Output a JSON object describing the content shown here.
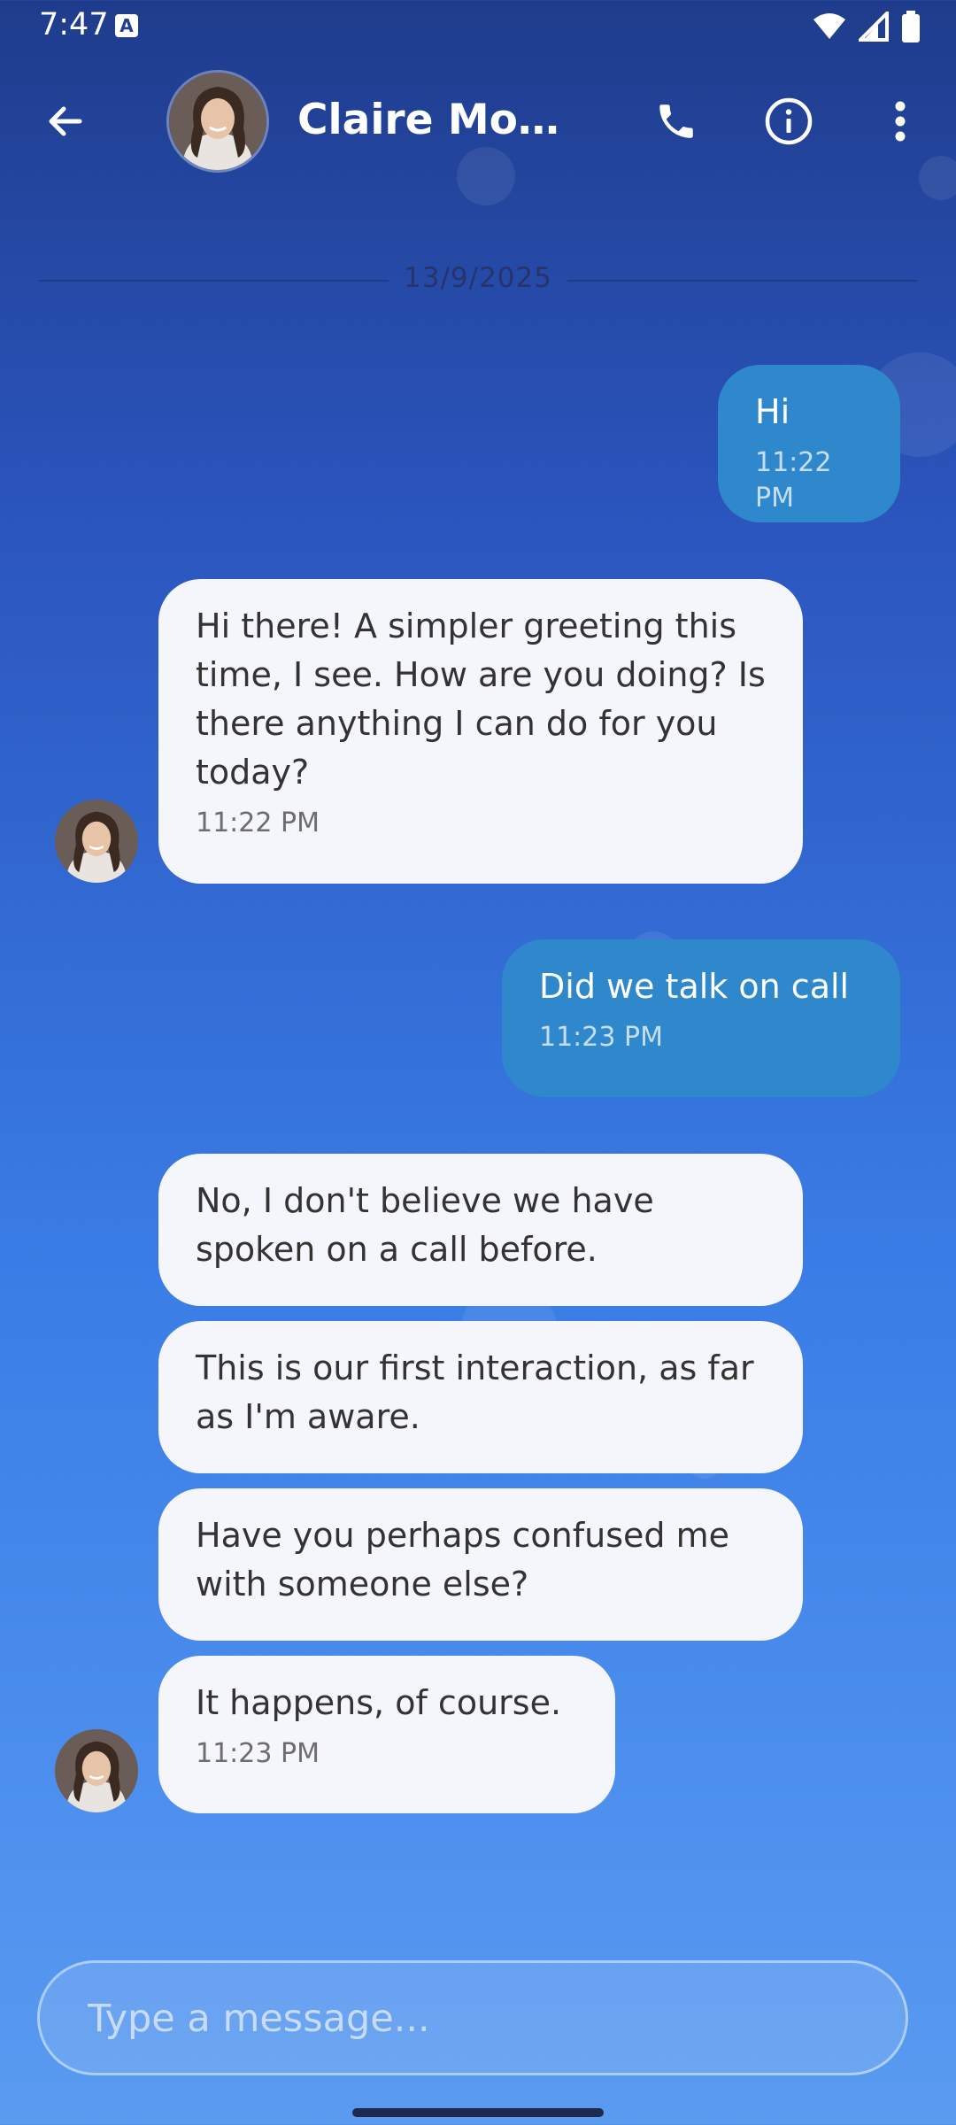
{
  "status_bar": {
    "time": "7:47",
    "notification_badge": "A"
  },
  "header": {
    "contact_name": "Claire Mont…",
    "back_icon": "arrow-left-icon",
    "call_icon": "phone-icon",
    "info_icon": "info-circle-icon",
    "more_icon": "more-vertical-icon"
  },
  "date_separator": "13/9/2025",
  "messages": [
    {
      "side": "sent",
      "text": "Hi",
      "time": "11:22 PM"
    },
    {
      "side": "received",
      "text": "Hi there! A simpler greeting this time, I see. How are you doing? Is there anything I can do for you today?",
      "time": "11:22 PM"
    },
    {
      "side": "sent",
      "text": "Did we talk on call",
      "time": "11:23 PM"
    },
    {
      "side": "received",
      "text": "No, I don't believe we have spoken on a call before."
    },
    {
      "side": "received",
      "text": "This is our first interaction, as far as I'm aware."
    },
    {
      "side": "received",
      "text": "Have you perhaps confused me with someone else?"
    },
    {
      "side": "received",
      "text": "It happens, of course.",
      "time": "11:23 PM"
    }
  ],
  "composer": {
    "placeholder": "Type a message..."
  },
  "colors": {
    "sent_bubble": "#2f88cc",
    "received_bubble": "#f5f6fb",
    "accent": "#3a7de6"
  }
}
